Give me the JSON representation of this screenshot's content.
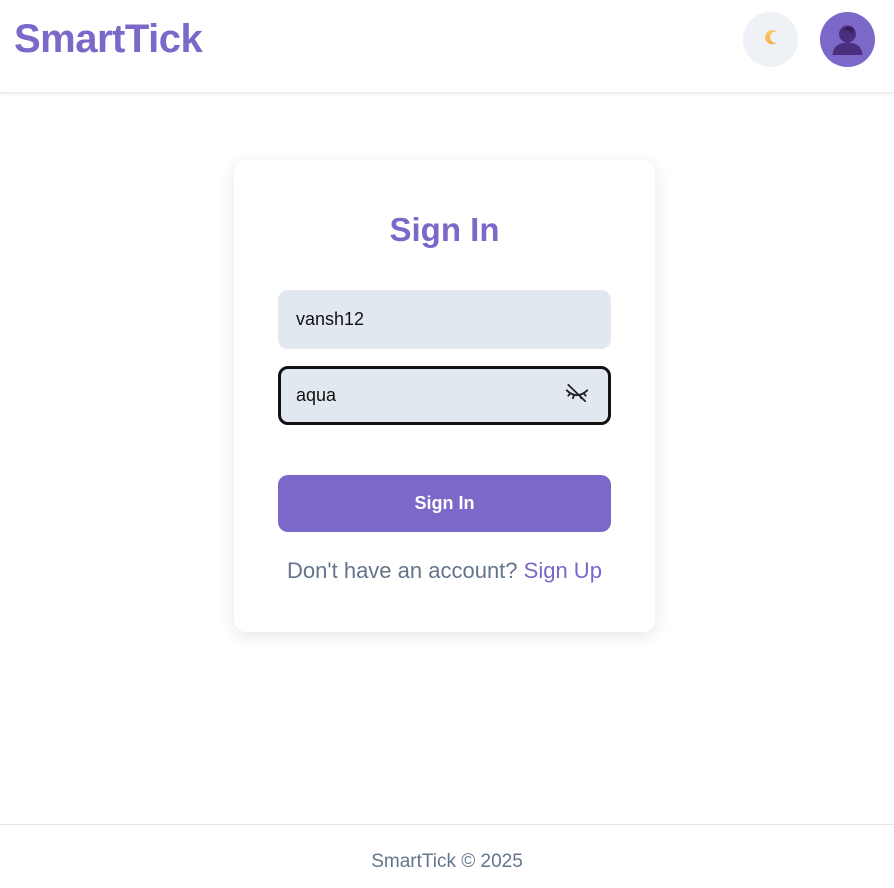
{
  "header": {
    "brand": "SmartTick",
    "theme_toggle_icon": "moon-icon",
    "avatar_icon": "user-avatar-icon"
  },
  "signin": {
    "title": "Sign In",
    "username": {
      "value": "vansh12"
    },
    "password": {
      "value": "aqua",
      "toggle_icon": "eye-off-icon"
    },
    "submit_label": "Sign In",
    "prompt_text": "Don't have an account?",
    "signup_link": "Sign Up"
  },
  "footer": {
    "text": "SmartTick © 2025"
  },
  "colors": {
    "accent": "#7b68c8",
    "input_bg": "#e2e8f0",
    "muted_text": "#64748b"
  }
}
